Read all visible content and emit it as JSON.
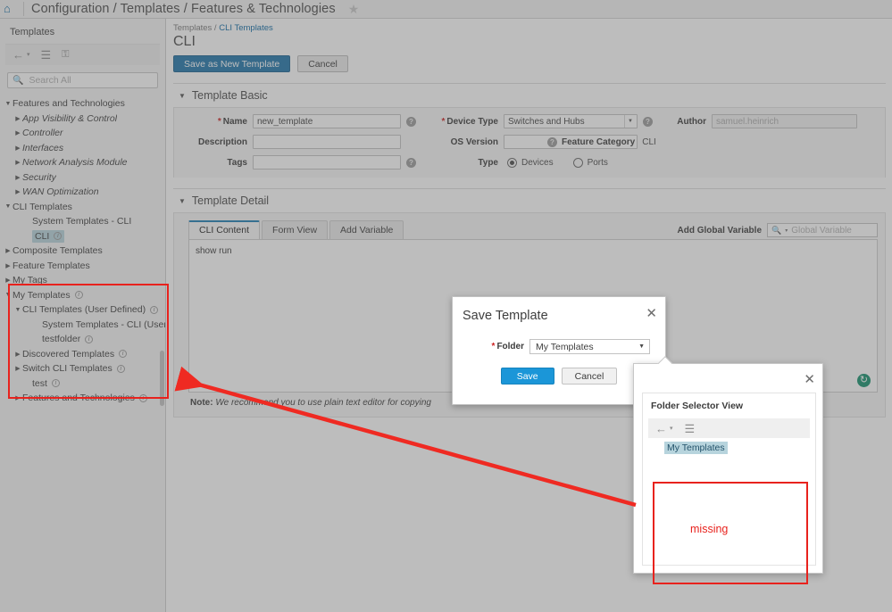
{
  "topbar": {
    "home_icon": "home-icon",
    "breadcrumb": "Configuration / Templates / Features & Technologies",
    "favorite_icon": "star-icon"
  },
  "sidebar": {
    "title": "Templates",
    "tools": [
      {
        "name": "back-arrow-icon",
        "glyph": "←"
      },
      {
        "name": "chevron-down-icon",
        "glyph": "▾"
      },
      {
        "name": "list-view-icon",
        "glyph": "≡"
      },
      {
        "name": "lock-icon",
        "glyph": "⚿"
      }
    ],
    "search": {
      "value": "",
      "placeholder": "Search All"
    },
    "tree": [
      {
        "label": "Features and Technologies",
        "indent": 0,
        "state": "open",
        "italic": false,
        "info": false
      },
      {
        "label": "App Visibility & Control",
        "indent": 1,
        "state": "closed",
        "italic": true,
        "info": false
      },
      {
        "label": "Controller",
        "indent": 1,
        "state": "closed",
        "italic": true,
        "info": false
      },
      {
        "label": "Interfaces",
        "indent": 1,
        "state": "closed",
        "italic": true,
        "info": false
      },
      {
        "label": "Network Analysis Module",
        "indent": 1,
        "state": "closed",
        "italic": true,
        "info": false
      },
      {
        "label": "Security",
        "indent": 1,
        "state": "closed",
        "italic": true,
        "info": false
      },
      {
        "label": "WAN Optimization",
        "indent": 1,
        "state": "closed",
        "italic": true,
        "info": false
      },
      {
        "label": "CLI Templates",
        "indent": 0,
        "state": "open",
        "italic": false,
        "info": false
      },
      {
        "label": "System Templates - CLI",
        "indent": 2,
        "state": "leaf",
        "italic": false,
        "info": false
      },
      {
        "label": "CLI",
        "indent": 2,
        "state": "leaf",
        "italic": false,
        "info": true,
        "selected": true
      },
      {
        "label": "Composite Templates",
        "indent": 0,
        "state": "closed",
        "italic": false,
        "info": false
      },
      {
        "label": "Feature Templates",
        "indent": 0,
        "state": "closed",
        "italic": false,
        "info": false
      },
      {
        "label": "My Tags",
        "indent": 0,
        "state": "closed",
        "italic": false,
        "info": false
      },
      {
        "label": "My Templates",
        "indent": 0,
        "state": "open",
        "italic": false,
        "info": true
      },
      {
        "label": "CLI Templates (User Defined)",
        "indent": 1,
        "state": "open",
        "italic": false,
        "info": true
      },
      {
        "label": "System Templates - CLI (User Define",
        "indent": 3,
        "state": "leaf",
        "italic": false,
        "info": false
      },
      {
        "label": "testfolder",
        "indent": 3,
        "state": "leaf",
        "italic": false,
        "info": true
      },
      {
        "label": "Discovered Templates",
        "indent": 1,
        "state": "closed",
        "italic": false,
        "info": true
      },
      {
        "label": "Switch CLI Templates",
        "indent": 1,
        "state": "closed",
        "italic": false,
        "info": true
      },
      {
        "label": "test",
        "indent": 2,
        "state": "leaf",
        "italic": false,
        "info": true
      },
      {
        "label": "Features and Technologies",
        "indent": 1,
        "state": "closed",
        "italic": false,
        "info": true
      }
    ]
  },
  "main": {
    "breadcrumb_prefix": "Templates / ",
    "breadcrumb_link": "CLI Templates",
    "page_title": "CLI",
    "save_as_new_label": "Save as New Template",
    "cancel_label": "Cancel",
    "template_basic": {
      "title": "Template Basic",
      "name_label": "Name",
      "name_value": "new_template",
      "description_label": "Description",
      "description_value": "",
      "tags_label": "Tags",
      "tags_value": "",
      "device_type_label": "Device Type",
      "device_type_value": "Switches and Hubs",
      "os_version_label": "OS Version",
      "os_version_value": "",
      "type_label": "Type",
      "type_options": [
        "Devices",
        "Ports"
      ],
      "type_selected": "Devices",
      "author_label": "Author",
      "author_value": "samuel.heinrich",
      "feature_category_label": "Feature Category",
      "feature_category_value": "CLI"
    },
    "template_detail": {
      "title": "Template Detail",
      "tabs": [
        {
          "label": "CLI Content",
          "active": true
        },
        {
          "label": "Form View",
          "active": false
        },
        {
          "label": "Add Variable",
          "active": false
        }
      ],
      "add_global_variable_label": "Add Global Variable",
      "global_variable_placeholder": "Global Variable",
      "global_variable_value": "",
      "editor_content": "show run",
      "refresh_icon": "refresh-icon",
      "note_bold": "Note:",
      "note_text": " We recommend you to use plain text editor for copying"
    }
  },
  "modal": {
    "title": "Save Template",
    "close_icon": "close-icon",
    "folder_label": "Folder",
    "folder_value": "My Templates",
    "save_label": "Save",
    "cancel_label": "Cancel"
  },
  "folder_popup": {
    "close_icon": "close-icon",
    "header": "Folder Selector View",
    "tools": [
      {
        "name": "back-arrow-icon",
        "glyph": "←"
      },
      {
        "name": "chevron-down-icon",
        "glyph": "▾"
      },
      {
        "name": "list-view-icon",
        "glyph": "≡"
      }
    ],
    "root_item": "My Templates",
    "empty_message": "missing"
  },
  "annotation": {
    "highlight_color": "#e8221d",
    "arrow_name": "annotation-arrow"
  }
}
